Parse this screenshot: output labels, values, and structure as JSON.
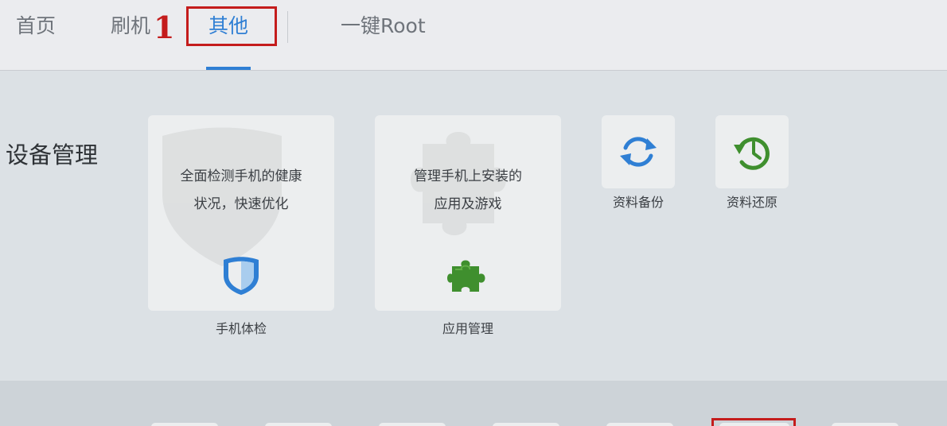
{
  "nav": {
    "tabs": [
      {
        "label": "首页",
        "active": false
      },
      {
        "label": "刷机",
        "active": false
      },
      {
        "label": "其他",
        "active": true
      },
      {
        "label": "一键Root",
        "active": false
      }
    ],
    "active_color": "#2f7fd4"
  },
  "annotation": {
    "step_number": "1",
    "color": "#c41c1c"
  },
  "section": {
    "title": "设备管理",
    "cards": [
      {
        "desc_line1": "全面检测手机的健康",
        "desc_line2": "状况，快速优化",
        "label": "手机体检",
        "icon": "shield-icon"
      },
      {
        "desc_line1": "管理手机上安装的",
        "desc_line2": "应用及游戏",
        "label": "应用管理",
        "icon": "puzzle-icon"
      }
    ],
    "tiles": [
      {
        "label": "资料备份",
        "icon": "sync-icon"
      },
      {
        "label": "资料还原",
        "icon": "history-icon"
      }
    ]
  }
}
